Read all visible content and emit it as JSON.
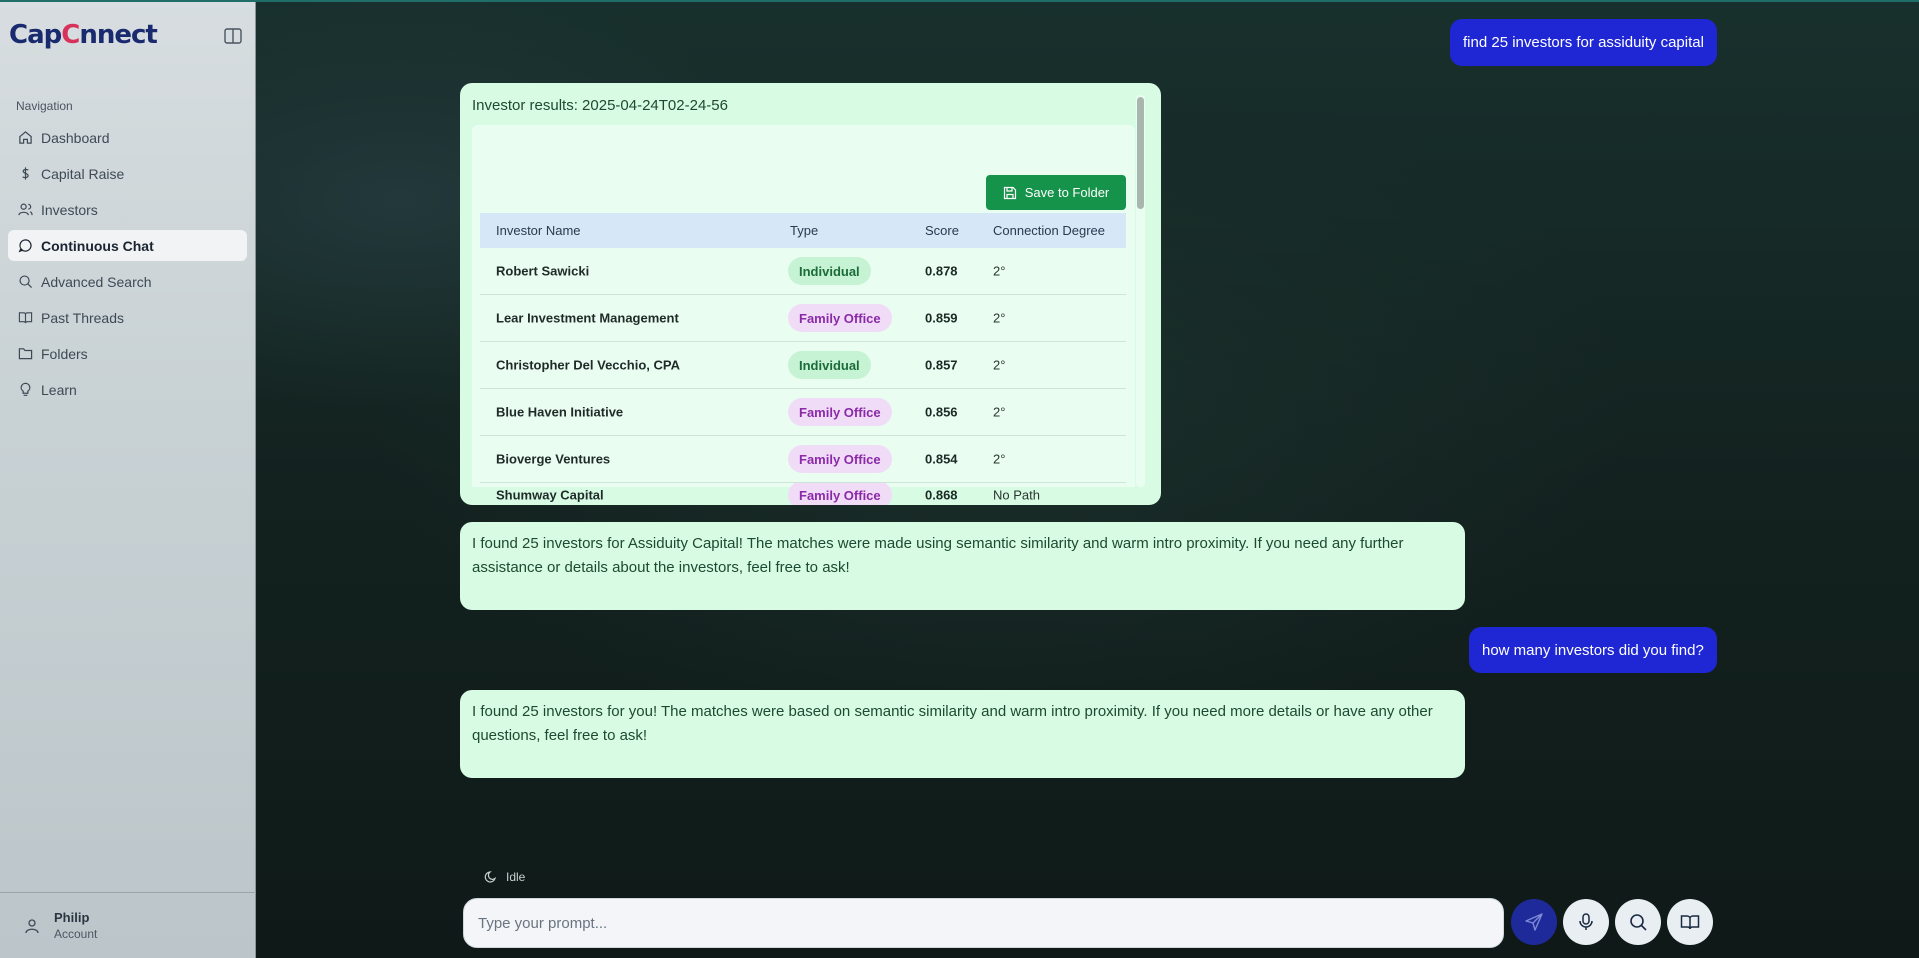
{
  "app": {
    "logo_text_a": "Cap",
    "logo_text_b": "C",
    "logo_text_c": "nnect"
  },
  "sidebar": {
    "heading": "Navigation",
    "items": [
      {
        "label": "Dashboard",
        "icon": "home-icon"
      },
      {
        "label": "Capital Raise",
        "icon": "dollar-icon"
      },
      {
        "label": "Investors",
        "icon": "users-icon"
      },
      {
        "label": "Continuous Chat",
        "icon": "chat-icon",
        "active": true
      },
      {
        "label": "Advanced Search",
        "icon": "search-icon"
      },
      {
        "label": "Past Threads",
        "icon": "book-icon"
      },
      {
        "label": "Folders",
        "icon": "folder-icon"
      },
      {
        "label": "Learn",
        "icon": "lightbulb-icon"
      }
    ],
    "account": {
      "name": "Philip",
      "sub": "Account"
    }
  },
  "chat": {
    "user_msg_1": "find 25 investors for assiduity capital",
    "results_title": "Investor results: 2025-04-24T02-24-56",
    "save_label": "Save to Folder",
    "columns": [
      "Investor Name",
      "Type",
      "Score",
      "Connection Degree"
    ],
    "rows": [
      {
        "name": "Robert Sawicki",
        "type": "Individual",
        "score": "0.878",
        "conn": "2°"
      },
      {
        "name": "Lear Investment Management",
        "type": "Family Office",
        "score": "0.859",
        "conn": "2°"
      },
      {
        "name": "Christopher Del Vecchio, CPA",
        "type": "Individual",
        "score": "0.857",
        "conn": "2°"
      },
      {
        "name": "Blue Haven Initiative",
        "type": "Family Office",
        "score": "0.856",
        "conn": "2°"
      },
      {
        "name": "Bioverge Ventures",
        "type": "Family Office",
        "score": "0.854",
        "conn": "2°"
      },
      {
        "name": "Shumway Capital",
        "type": "Family Office",
        "score": "0.868",
        "conn": "No Path"
      }
    ],
    "bot_msg_1": "I found 25 investors for Assiduity Capital! The matches were made using semantic similarity and warm intro proximity. If you need any further assistance or details about the investors, feel free to ask!",
    "user_msg_2": "how many investors did you find?",
    "bot_msg_2": "I found 25 investors for you! The matches were based on semantic similarity and warm intro proximity. If you need more details or have any other questions, feel free to ask!"
  },
  "composer": {
    "status": "Idle",
    "placeholder": "Type your prompt...",
    "buttons": [
      "send-icon",
      "microphone-icon",
      "search-icon",
      "book-open-icon"
    ]
  },
  "colors": {
    "accent": "#1f27d4",
    "bubble": "#d8fbe4",
    "save": "#16934a"
  }
}
